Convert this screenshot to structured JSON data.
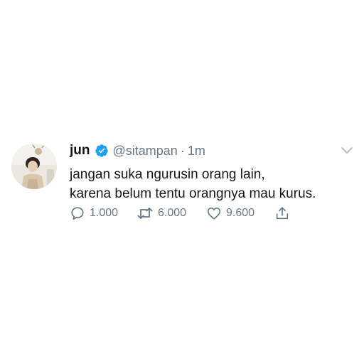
{
  "tweet": {
    "author": {
      "name": "jun",
      "handle": "@sitampan",
      "verified": true
    },
    "separator": "·",
    "timestamp": "1m",
    "text_lines": [
      "jangan suka ngurusin orang lain,",
      "karena belum tentu orangnya mau kurus."
    ],
    "actions": {
      "reply_count": "1.000",
      "retweet_count": "6.000",
      "like_count": "9.600"
    }
  },
  "icons": {
    "verified": "verified-badge-icon",
    "menu": "chevron-down-icon",
    "reply": "reply-bubble-icon",
    "retweet": "retweet-icon",
    "like": "heart-icon",
    "share": "share-icon"
  },
  "colors": {
    "text": "#14171a",
    "secondary": "#657786",
    "verified": "#1da1f2",
    "background": "#ffffff"
  }
}
